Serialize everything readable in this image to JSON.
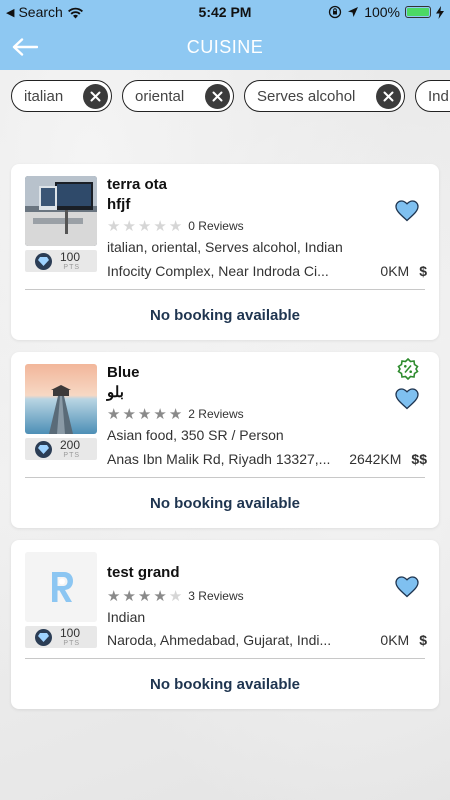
{
  "status_bar": {
    "back_app": "Search",
    "time": "5:42 PM",
    "battery": "100%"
  },
  "header": {
    "title": "CUISINE"
  },
  "filters": [
    {
      "label": "italian"
    },
    {
      "label": "oriental"
    },
    {
      "label": "Serves alcohol"
    },
    {
      "label": "Ind"
    }
  ],
  "colors": {
    "header_bg": "#8ec8f2",
    "heart": "#7fc0f0",
    "booking_text": "#1f3550"
  },
  "restaurants": [
    {
      "name": "terra  ota",
      "subname": "hfjf",
      "rating": 0,
      "reviews": "0 Reviews",
      "cuisine": "italian, oriental, Serves alcohol, Indian",
      "address": "Infocity Complex, Near Indroda Ci...",
      "distance": "0KM",
      "price": "$",
      "points": "100",
      "points_label": "PTS",
      "booking": "No booking available",
      "image": "office-computer-photo",
      "has_offer": false
    },
    {
      "name": "Blue",
      "subname": "بلو",
      "rating": 5,
      "reviews": "2 Reviews",
      "cuisine": "Asian food, 350 SR / Person",
      "address": "Anas Ibn Malik Rd, Riyadh 13327,...",
      "distance": "2642KM",
      "price": "$$",
      "points": "200",
      "points_label": "PTS",
      "booking": "No booking available",
      "image": "pier-sunset-photo",
      "has_offer": true
    },
    {
      "name": "test grand",
      "subname": "",
      "rating": 4,
      "reviews": "3 Reviews",
      "cuisine": "Indian",
      "address": "Naroda, Ahmedabad, Gujarat, Indi...",
      "distance": "0KM",
      "price": "$",
      "points": "100",
      "points_label": "PTS",
      "booking": "No booking available",
      "image": "r-logo",
      "has_offer": false
    }
  ]
}
